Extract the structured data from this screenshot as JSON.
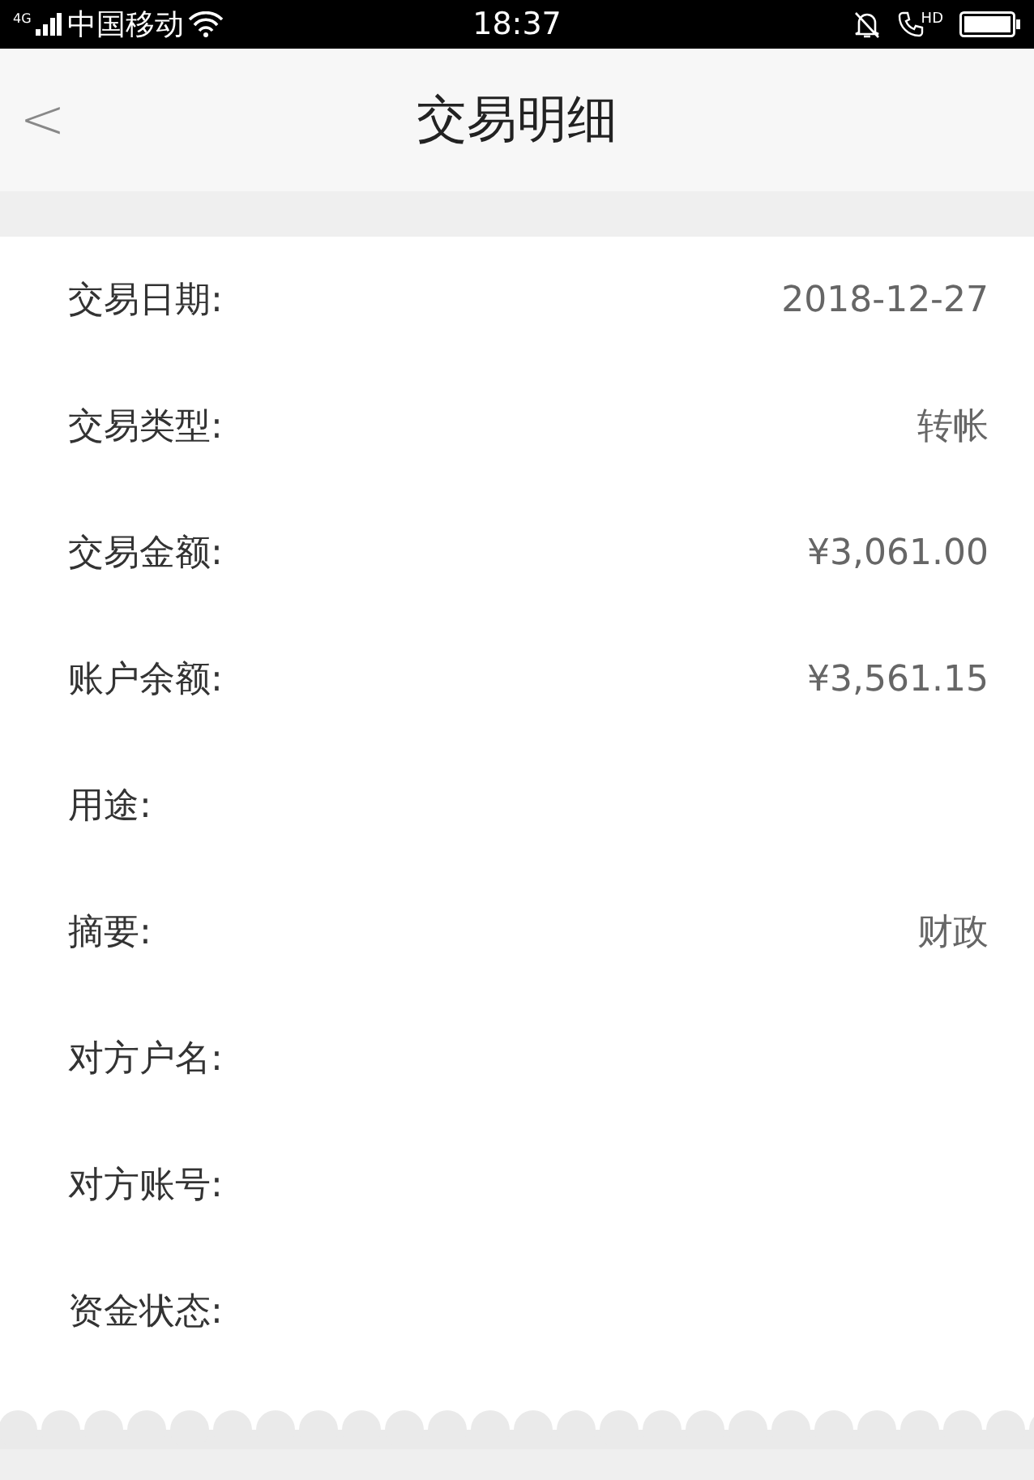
{
  "status_bar": {
    "network": "4G",
    "carrier": "中国移动",
    "time": "18:37",
    "call_badge": "HD"
  },
  "nav": {
    "back": "<",
    "title": "交易明细"
  },
  "rows": [
    {
      "label": "交易日期:",
      "value": "2018-12-27"
    },
    {
      "label": "交易类型:",
      "value": "转帐"
    },
    {
      "label": "交易金额:",
      "value": "¥3,061.00"
    },
    {
      "label": "账户余额:",
      "value": "¥3,561.15"
    },
    {
      "label": "用途:"
    },
    {
      "label": "摘要:",
      "value": "财政"
    },
    {
      "label": "对方户名:"
    },
    {
      "label": "对方账号:"
    },
    {
      "label": "资金状态:"
    }
  ]
}
